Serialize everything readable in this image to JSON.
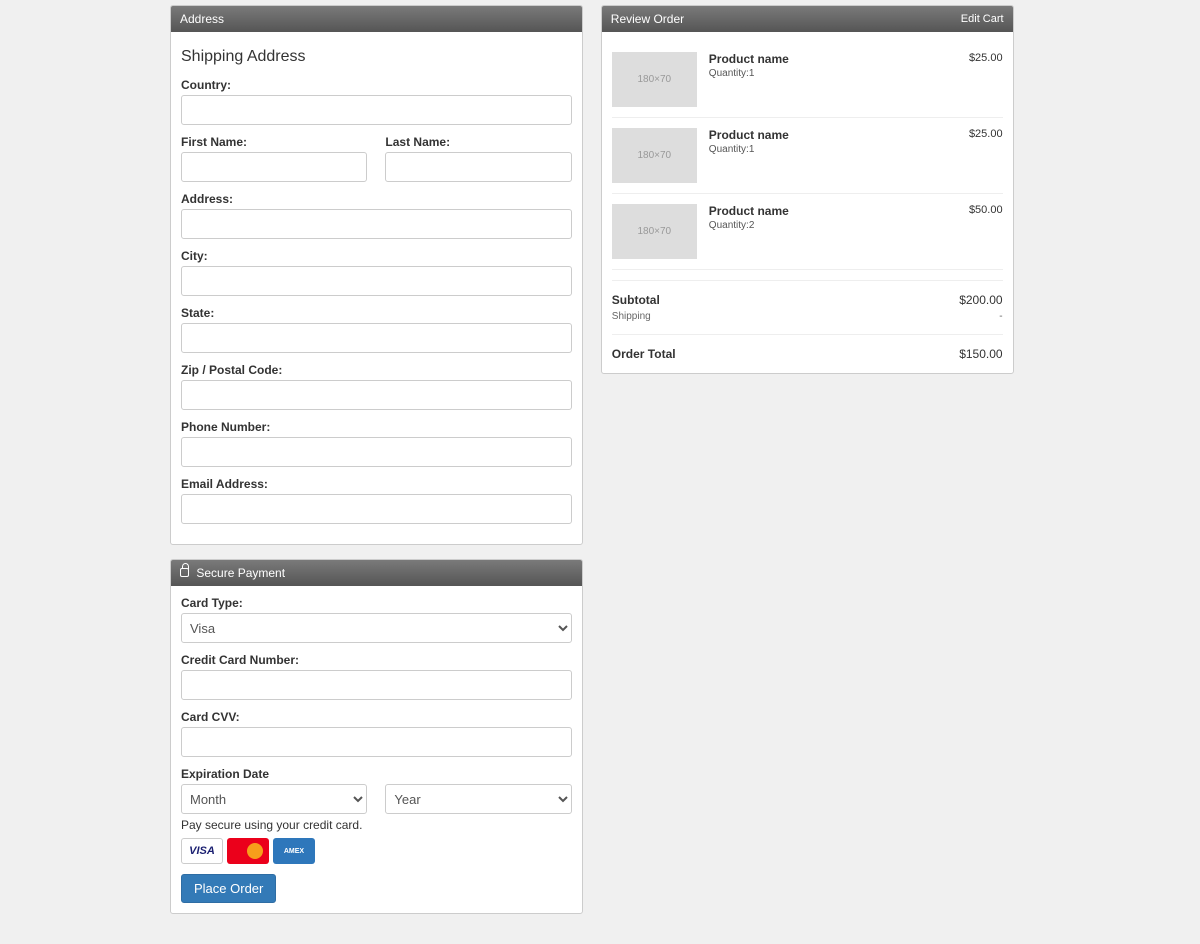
{
  "address_panel": {
    "heading": "Address",
    "title": "Shipping Address",
    "labels": {
      "country": "Country:",
      "first_name": "First Name:",
      "last_name": "Last Name:",
      "address": "Address:",
      "city": "City:",
      "state": "State:",
      "zip": "Zip / Postal Code:",
      "phone": "Phone Number:",
      "email": "Email Address:"
    }
  },
  "payment_panel": {
    "heading": "Secure Payment",
    "labels": {
      "card_type": "Card Type:",
      "card_number": "Credit Card Number:",
      "cvv": "Card CVV:",
      "expiry": "Expiration Date"
    },
    "card_type_value": "Visa",
    "month_value": "Month",
    "year_value": "Year",
    "note": "Pay secure using your credit card.",
    "visa_label": "VISA",
    "amex_label": "AMEX",
    "submit": "Place Order"
  },
  "review_panel": {
    "heading": "Review Order",
    "edit_link": "Edit Cart",
    "thumb_text": "180×70",
    "items": [
      {
        "name": "Product name",
        "qty": "Quantity:1",
        "price": "$25.00"
      },
      {
        "name": "Product name",
        "qty": "Quantity:1",
        "price": "$25.00"
      },
      {
        "name": "Product name",
        "qty": "Quantity:2",
        "price": "$50.00"
      }
    ],
    "subtotal_label": "Subtotal",
    "subtotal_value": "$200.00",
    "shipping_label": "Shipping",
    "shipping_value": "-",
    "total_label": "Order Total",
    "total_value": "$150.00"
  }
}
